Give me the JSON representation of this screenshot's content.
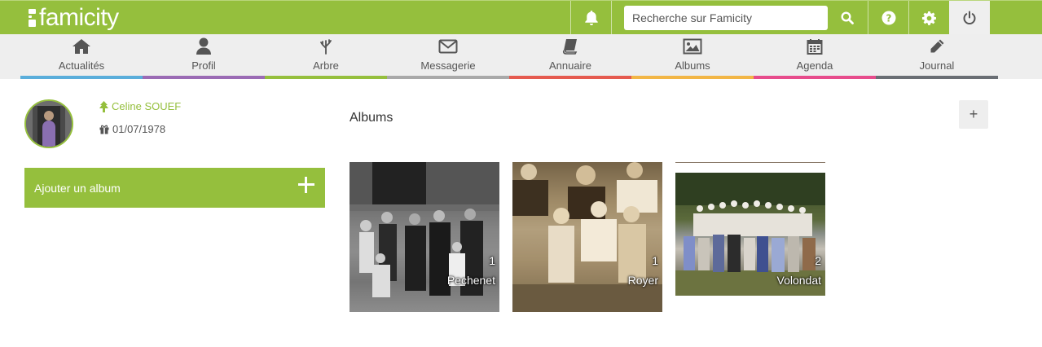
{
  "app": {
    "logo_text": "famicity"
  },
  "topbar": {
    "search_placeholder": "Recherche sur Famicity",
    "icons": [
      "bell-icon",
      "search-icon",
      "help-icon",
      "gear-icon",
      "power-icon"
    ]
  },
  "nav": {
    "items": [
      {
        "label": "Actualités",
        "icon": "home-icon",
        "color": "#5aaedb"
      },
      {
        "label": "Profil",
        "icon": "user-icon",
        "color": "#9b6bb5"
      },
      {
        "label": "Arbre",
        "icon": "tree-icon",
        "color": "#95bf3d"
      },
      {
        "label": "Messagerie",
        "icon": "envelope-icon",
        "color": "#a9a9a9"
      },
      {
        "label": "Annuaire",
        "icon": "book-icon",
        "color": "#e55a4f"
      },
      {
        "label": "Albums",
        "icon": "image-icon",
        "color": "#f2b646"
      },
      {
        "label": "Agenda",
        "icon": "calendar-icon",
        "color": "#e74c8c"
      },
      {
        "label": "Journal",
        "icon": "pencil-icon",
        "color": "#6a6e74"
      }
    ]
  },
  "profile": {
    "name": "Celine SOUEF",
    "birthdate": "01/07/1978"
  },
  "sidebar": {
    "add_album_label": "Ajouter un album"
  },
  "main": {
    "title": "Albums",
    "add_button": "+"
  },
  "albums": [
    {
      "name": "Pechenet",
      "count": "1"
    },
    {
      "name": "Royer",
      "count": "1"
    },
    {
      "name": "Volondat",
      "count": "2"
    }
  ],
  "colors": {
    "brand": "#95bf3d",
    "nav_bg": "#eeeeee"
  }
}
